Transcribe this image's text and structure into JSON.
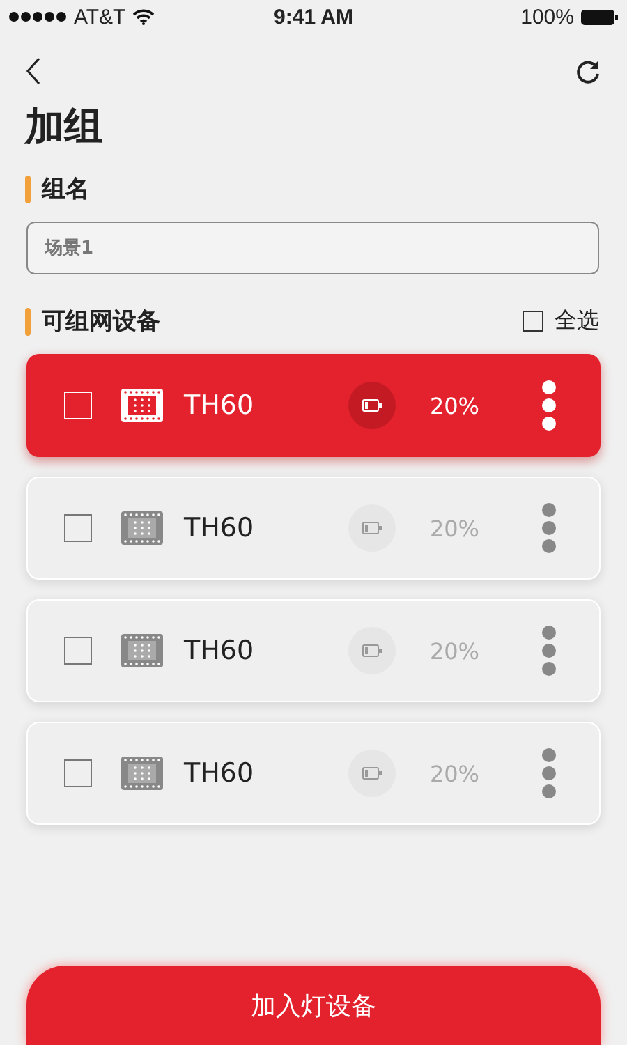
{
  "status_bar": {
    "carrier": "AT&T",
    "time": "9:41 AM",
    "battery": "100%"
  },
  "title": "加组",
  "name_section": {
    "label": "组名",
    "field": {
      "value": "场景1"
    }
  },
  "devices_section": {
    "label": "可组网设备",
    "select_all": {
      "label": "全选",
      "checked": false
    }
  },
  "devices": [
    {
      "name": "TH60",
      "battery": "20%",
      "selected": true,
      "checked": false
    },
    {
      "name": "TH60",
      "battery": "20%",
      "selected": false,
      "checked": false
    },
    {
      "name": "TH60",
      "battery": "20%",
      "selected": false,
      "checked": false
    },
    {
      "name": "TH60",
      "battery": "20%",
      "selected": false,
      "checked": false
    }
  ],
  "add_button": "加入灯设备"
}
